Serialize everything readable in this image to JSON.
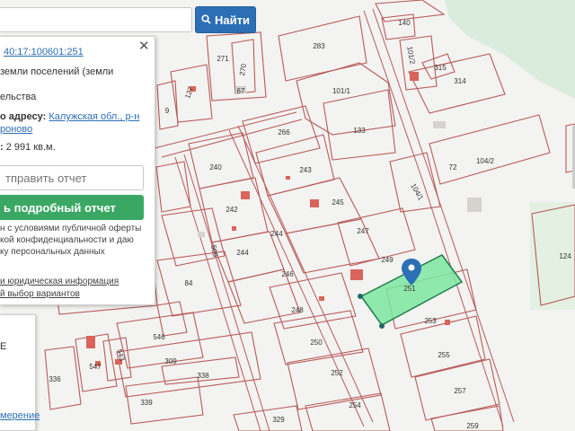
{
  "search": {
    "placeholder": "",
    "value": "",
    "button_label": "Найти"
  },
  "info_panel": {
    "cadastral_number": "40:17:100601:251",
    "category_text": "земли поселений (земли",
    "usage_text": "ельства",
    "address_label": "о адресу:",
    "address_value_1": "Калужская обл., р-н",
    "address_value_2": "роново",
    "area_label": ":",
    "area_value": "2 991 кв.м.",
    "send_placeholder": "тправить отчет",
    "report_button": "ь подробный отчет",
    "consent_line_1": "н с условиями публичной оферты",
    "consent_line_2": "кой конфиденциальности и даю",
    "consent_line_3": "ку персональных данных",
    "legal_link": "и юридическая информация",
    "variants_link": "й выбор вариантов",
    "close_symbol": "✕"
  },
  "side_panel": {
    "mark": "E",
    "measure_link": "мерение"
  },
  "map": {
    "selected_parcel": "251",
    "parcel_labels": [
      "140",
      "283",
      "101/2",
      "315",
      "314",
      "271",
      "270",
      "67",
      "127",
      "9",
      "101/1",
      "133",
      "266",
      "240",
      "243",
      "72",
      "104/2",
      "104/1",
      "242",
      "245",
      "124",
      "244",
      "247",
      "249",
      "509",
      "244",
      "246",
      "84",
      "248",
      "253",
      "546",
      "250",
      "255",
      "547",
      "543",
      "309",
      "252",
      "257",
      "338",
      "336",
      "339",
      "254",
      "329",
      "259"
    ]
  },
  "colors": {
    "parcel_border": "#b85a5a",
    "building": "#d9645b",
    "selected_fill": "#7de6a0",
    "selected_border": "#1e7f4a",
    "accent_blue": "#2d6fb5",
    "accent_green": "#3aa864"
  }
}
